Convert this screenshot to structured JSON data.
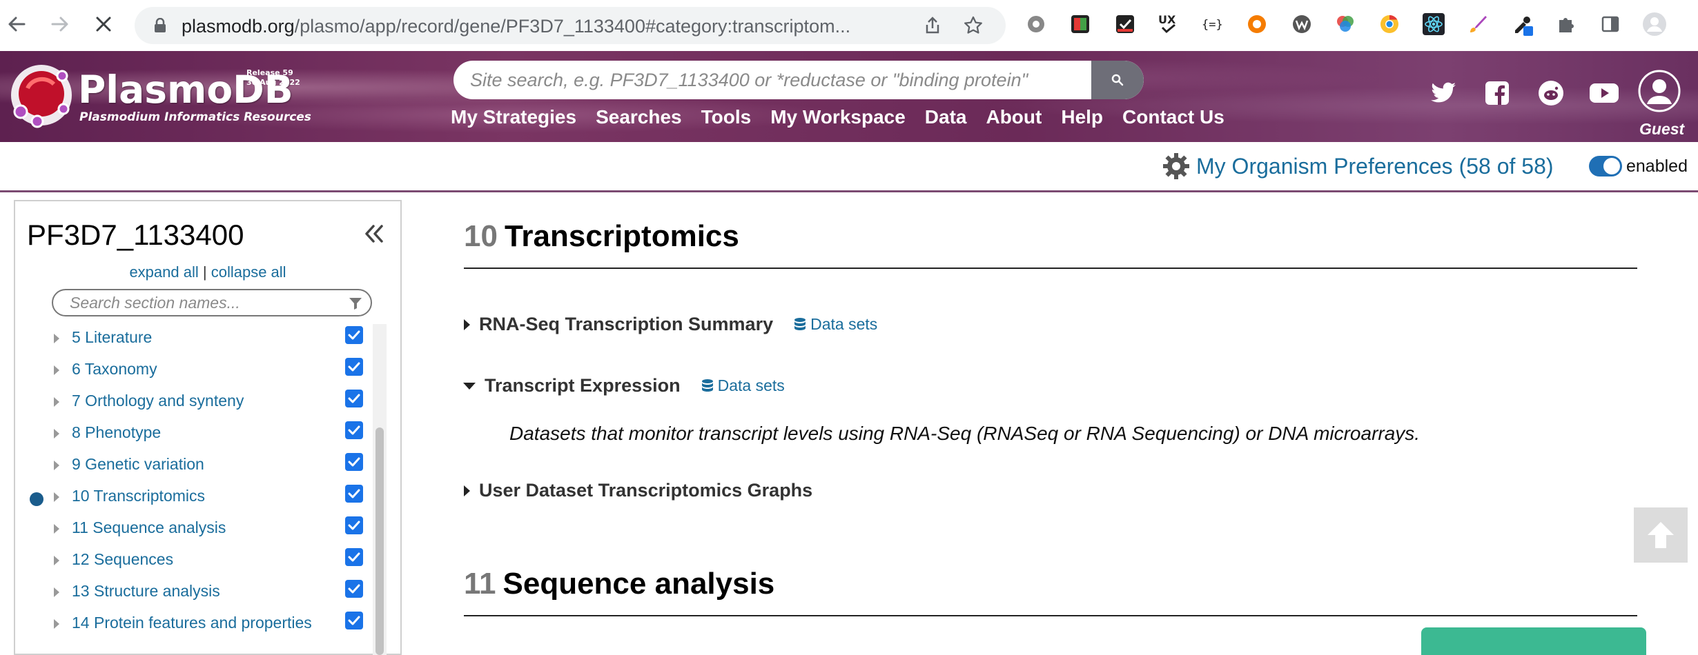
{
  "browser": {
    "url_host": "plasmodb.org",
    "url_path": "/plasmo/app/record/gene/PF3D7_1133400#category:transcriptom..."
  },
  "site": {
    "brand": "PlasmoDB",
    "tagline": "Plasmodium Informatics Resources",
    "release_line1": "Release 59",
    "release_line2": "30 Aug 2022",
    "search_placeholder": "Site search, e.g. PF3D7_1133400 or *reductase or \"binding protein\"",
    "menu": [
      "My Strategies",
      "Searches",
      "Tools",
      "My Workspace",
      "Data",
      "About",
      "Help",
      "Contact Us"
    ],
    "guest_label": "Guest",
    "accent_color": "#1a6d9c",
    "header_color": "#6b2a58"
  },
  "preferences": {
    "link_text": "My Organism Preferences (58 of 58)",
    "toggle_label": "enabled"
  },
  "sidebar": {
    "gene_id": "PF3D7_1133400",
    "expand_all": "expand all",
    "separator": "|",
    "collapse_all": "collapse all",
    "search_placeholder": "Search section names...",
    "items": [
      {
        "label": "5 Literature",
        "checked": true,
        "active": false
      },
      {
        "label": "6 Taxonomy",
        "checked": true,
        "active": false
      },
      {
        "label": "7 Orthology and synteny",
        "checked": true,
        "active": false
      },
      {
        "label": "8 Phenotype",
        "checked": true,
        "active": false
      },
      {
        "label": "9 Genetic variation",
        "checked": true,
        "active": false
      },
      {
        "label": "10 Transcriptomics",
        "checked": true,
        "active": true
      },
      {
        "label": "11 Sequence analysis",
        "checked": true,
        "active": false
      },
      {
        "label": "12 Sequences",
        "checked": true,
        "active": false
      },
      {
        "label": "13 Structure analysis",
        "checked": true,
        "active": false
      },
      {
        "label": "14 Protein features and properties",
        "checked": true,
        "active": false
      }
    ]
  },
  "main": {
    "sections": [
      {
        "number": "10",
        "title": "Transcriptomics"
      },
      {
        "number": "11",
        "title": "Sequence analysis"
      }
    ],
    "subsections": [
      {
        "title": "RNA-Seq Transcription Summary",
        "datasets_label": "Data sets",
        "expanded": false
      },
      {
        "title": "Transcript Expression",
        "datasets_label": "Data sets",
        "expanded": true
      },
      {
        "title": "User Dataset Transcriptomics Graphs",
        "datasets_label": "",
        "expanded": false
      }
    ],
    "transcript_expression_description": "Datasets that monitor transcript levels using RNA-Seq (RNASeq or RNA Sequencing) or DNA microarrays."
  }
}
